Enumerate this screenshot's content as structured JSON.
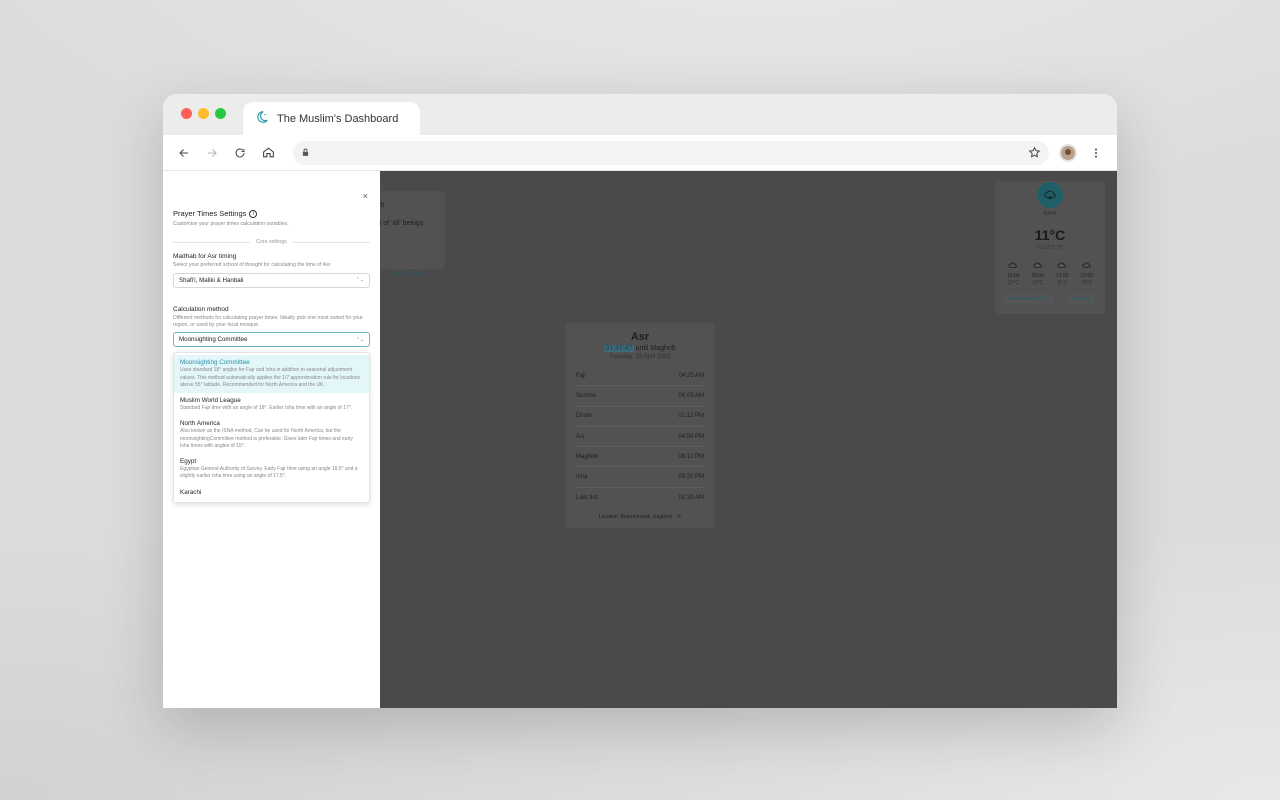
{
  "browser": {
    "tab_title": "The Muslim's Dashboard",
    "address": ""
  },
  "settings_panel": {
    "close_label": "×",
    "title": "Prayer Times Settings",
    "info_label": "i",
    "subtitle": "Customise your prayer times calculation variables.",
    "section_label": "Core settings",
    "madhab": {
      "label": "Madhab for Asr timing",
      "help": "Select your preferred school of thought for calculating the time of Asr",
      "selected": "Shafi'i, Maliki & Hanbali"
    },
    "calculation_method": {
      "label": "Calculation method",
      "help": "Different methods for calculating prayer times. Ideally pick one most suited for your region, or used by your local mosque.",
      "selected": "Moonsighting Committee",
      "options": [
        {
          "title": "Moonsighting Committee",
          "desc": "Uses standard 18° angles for Fajr and Isha in addition to seasonal adjustment values. This method automatically applies the 1/7 approximation rule for locations above 55° latitude. Recommended for North America and the UK."
        },
        {
          "title": "Muslim World League",
          "desc": "Standard Fajr time with an angle of 18°. Earlier Isha time with an angle of 17°."
        },
        {
          "title": "North America",
          "desc": "Also known as the ISNA method. Can be used for North America, but the moonsightingCommittee method is preferable. Gives later Fajr times and early Isha times with angles of 15°."
        },
        {
          "title": "Egypt",
          "desc": "Egyptian General Authority of Survey. Early Fajr time using an angle 19.5° and a slightly earlier Isha time using an angle of 17.5°."
        },
        {
          "title": "Karachi",
          "desc": ""
        }
      ]
    }
  },
  "background": {
    "hadith_fragment_1": "ih",
    "hadith_fragment_2": "est of 'all' beings",
    "read_more": "Read more",
    "prayer": {
      "current": "Asr",
      "countdown": "01:47:47",
      "until_text": "until Maghrib",
      "date": "Tuesday, 19 April 2022",
      "rows": [
        {
          "name": "Fajr",
          "time": "04:25 AM"
        },
        {
          "name": "Sunrise",
          "time": "06:05 AM"
        },
        {
          "name": "Dhuhr",
          "time": "01:12 PM"
        },
        {
          "name": "Asr",
          "time": "04:59 PM"
        },
        {
          "name": "Maghrib",
          "time": "08:12 PM"
        },
        {
          "name": "Isha",
          "time": "09:20 PM"
        },
        {
          "name": "Last 3rd",
          "time": "01:39 AM"
        }
      ],
      "location": "Location: Bournemouth, England"
    },
    "weather": {
      "condition": "RAIN",
      "temp": "11°C",
      "hilo": "H: 12° L: 9°",
      "forecast": [
        {
          "time": "19:00",
          "val": "12°C"
        },
        {
          "time": "20:00",
          "val": "11°C"
        },
        {
          "time": "21:00",
          "val": "11°C"
        },
        {
          "time": "22:00",
          "val": "10°C"
        }
      ],
      "location_badge": "BOURNEMOUTH",
      "time_badge": "05:24 PM"
    }
  }
}
